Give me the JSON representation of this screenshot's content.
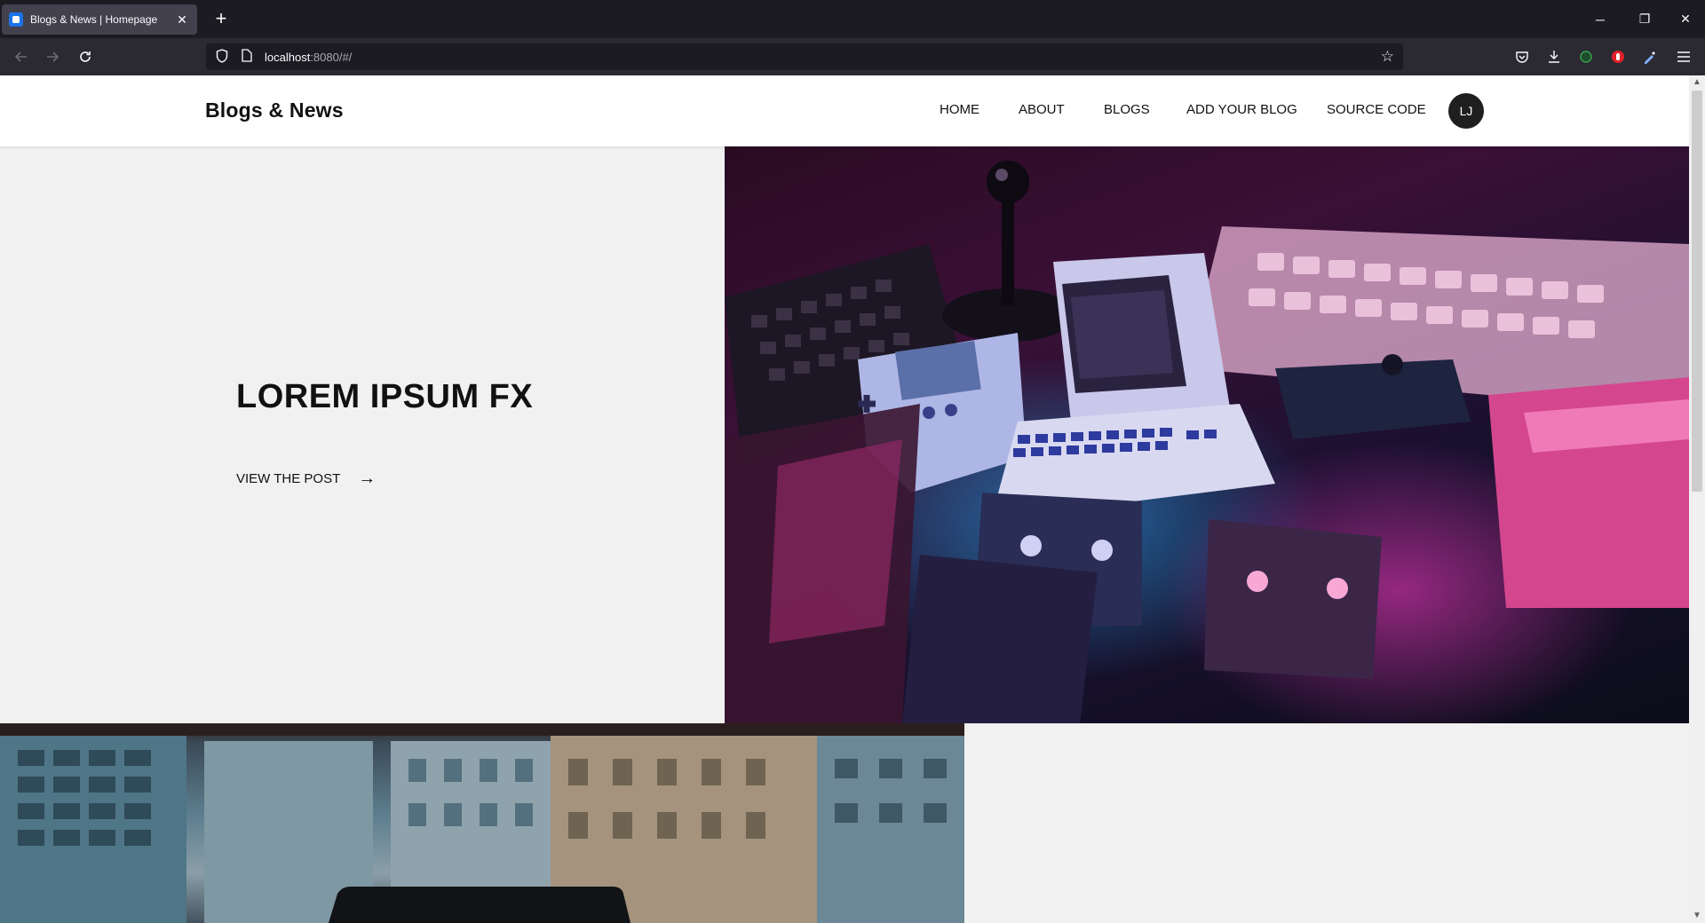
{
  "browser": {
    "tab_title": "Blogs & News | Homepage",
    "tab_close": "✕",
    "new_tab": "+",
    "url_host": "localhost",
    "url_rest": ":8080/#/",
    "window_controls": {
      "minimize": "─",
      "restore": "❐",
      "close": "✕"
    }
  },
  "site": {
    "brand": "Blogs & News",
    "nav": [
      "HOME",
      "ABOUT",
      "BLOGS",
      "ADD YOUR BLOG",
      "SOURCE CODE"
    ],
    "avatar_initials": "LJ"
  },
  "hero": {
    "title": "LOREM IPSUM FX",
    "link_label": "VIEW THE POST",
    "arrow": "→"
  },
  "colors": {
    "accent": "#1f1f1f",
    "page_bg": "#f2f1f1",
    "header_bg": "#ffffff"
  }
}
